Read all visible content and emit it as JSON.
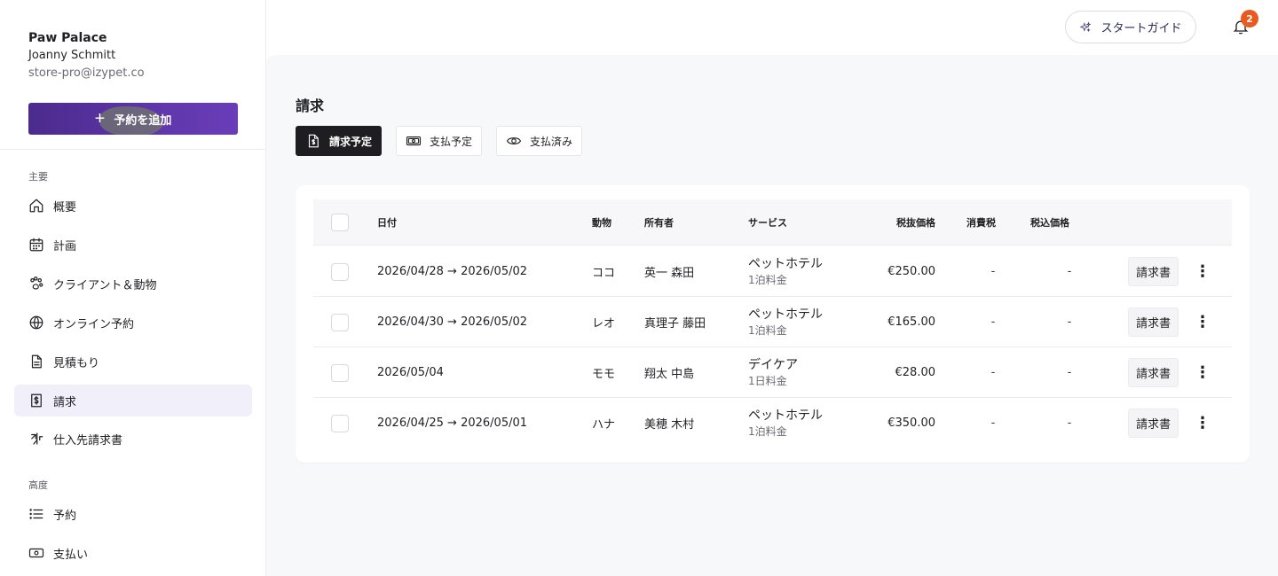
{
  "brand": {
    "name": "Paw Palace",
    "user": "Joanny Schmitt",
    "email": "store-pro@izypet.co"
  },
  "add_button": {
    "label": "予約を追加",
    "icon": "plus-icon"
  },
  "sections": {
    "main": "主要",
    "advanced": "高度"
  },
  "nav": [
    {
      "label": "概要",
      "icon": "home-icon"
    },
    {
      "label": "計画",
      "icon": "calendar-icon"
    },
    {
      "label": "クライアント＆動物",
      "icon": "paw-icon"
    },
    {
      "label": "オンライン予約",
      "icon": "globe-icon"
    },
    {
      "label": "見積もり",
      "icon": "document-icon"
    },
    {
      "label": "請求",
      "icon": "dollar-document-icon",
      "active": true
    },
    {
      "label": "仕入先請求書",
      "icon": "supplier-icon"
    },
    {
      "label": "予約",
      "icon": "list-icon"
    },
    {
      "label": "支払い",
      "icon": "money-icon"
    }
  ],
  "topbar": {
    "guide_label": "スタートガイド",
    "notification_count": "2"
  },
  "page": {
    "title": "請求"
  },
  "tabs": [
    {
      "label": "請求予定",
      "icon": "dollar-document-icon",
      "active": true
    },
    {
      "label": "支払予定",
      "icon": "money-icon"
    },
    {
      "label": "支払済み",
      "icon": "eye-icon"
    }
  ],
  "table": {
    "headers": {
      "date": "日付",
      "animal": "動物",
      "owner": "所有者",
      "service": "サービス",
      "price_excl": "税抜価格",
      "tax": "消費税",
      "price_incl": "税込価格"
    },
    "rows": [
      {
        "date": "2026/04/28 → 2026/05/02",
        "animal": "ココ",
        "owner": "英一 森田",
        "service": "ペットホテル",
        "service_sub": "1泊料金",
        "price_excl": "€250.00",
        "tax": "-",
        "price_incl": "-",
        "invoice": "請求書"
      },
      {
        "date": "2026/04/30 → 2026/05/02",
        "animal": "レオ",
        "owner": "真理子 藤田",
        "service": "ペットホテル",
        "service_sub": "1泊料金",
        "price_excl": "€165.00",
        "tax": "-",
        "price_incl": "-",
        "invoice": "請求書"
      },
      {
        "date": "2026/05/04",
        "animal": "モモ",
        "owner": "翔太 中島",
        "service": "デイケア",
        "service_sub": "1日料金",
        "price_excl": "€28.00",
        "tax": "-",
        "price_incl": "-",
        "invoice": "請求書"
      },
      {
        "date": "2026/04/25 → 2026/05/01",
        "animal": "ハナ",
        "owner": "美穂 木村",
        "service": "ペットホテル",
        "service_sub": "1泊料金",
        "price_excl": "€350.00",
        "tax": "-",
        "price_incl": "-",
        "invoice": "請求書"
      }
    ]
  }
}
